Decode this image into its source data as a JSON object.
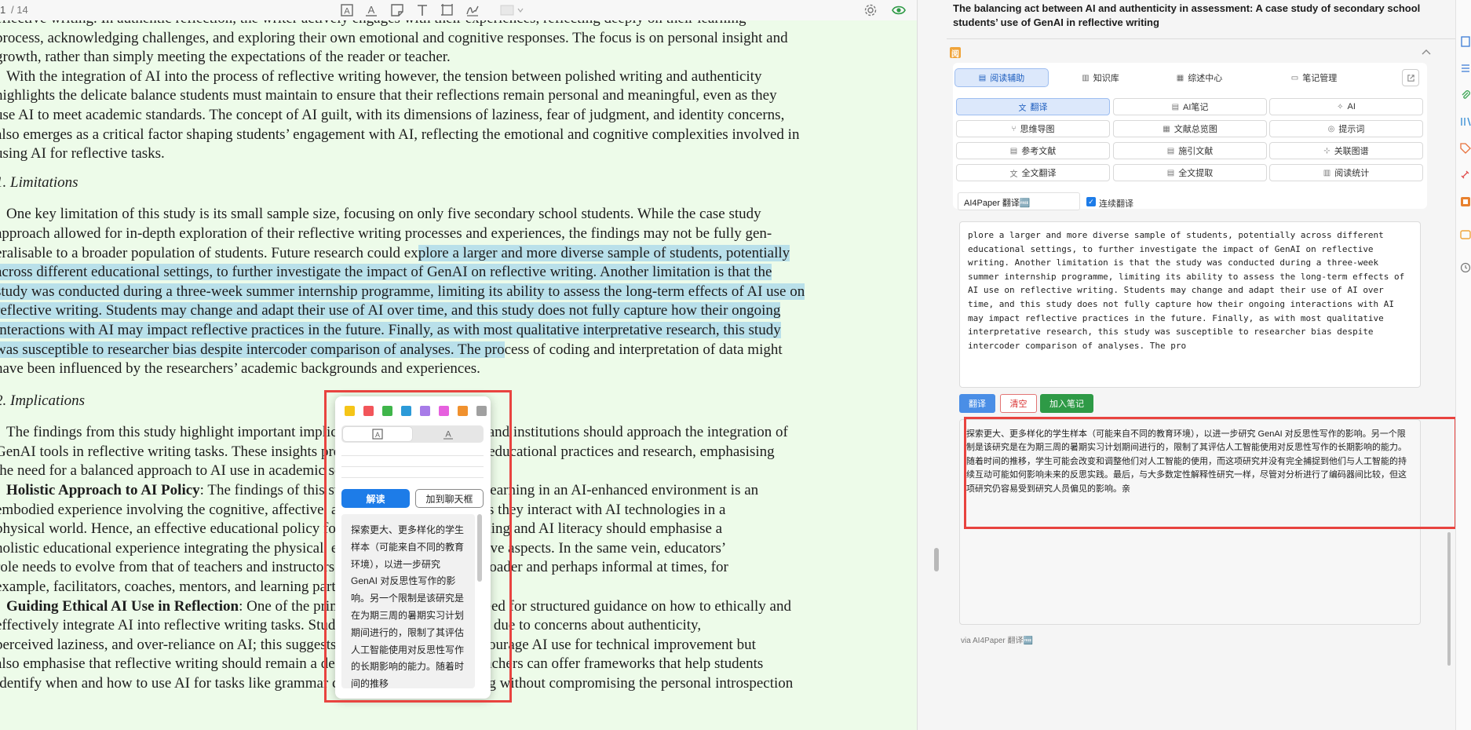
{
  "toolbar": {
    "page_current": "1",
    "page_total": "/ 14",
    "icons": [
      "text-box-icon",
      "text-highlight-icon",
      "note-icon",
      "text-icon",
      "area-select-icon",
      "signature-icon",
      "color-dropdown-icon",
      "gear-icon",
      "eye-icon",
      "search-icon"
    ]
  },
  "document": {
    "lines": [
      "eflective writing. In authentic reflection, the writer actively engages with their experiences, reflecting deeply on their learning",
      "process, acknowledging challenges, and exploring their own emotional and cognitive responses. The focus is on personal insight and",
      "growth, rather than simply meeting the expectations of the reader or teacher.",
      "With the integration of AI into the process of reflective writing however, the tension between polished writing and authenticity",
      "highlights the delicate balance students must maintain to ensure that their reflections remain personal and meaningful, even as they",
      "use AI to meet academic standards. The concept of AI guilt, with its dimensions of laziness, fear of judgment, and identity concerns,",
      "also emerges as a critical factor shaping students’ engagement with AI, reflecting the emotional and cognitive complexities involved in",
      "using AI for reflective tasks."
    ],
    "section_limitations": "1.   Limitations",
    "limit_line_1": "One key limitation of this study is its small sample size, focusing on only five secondary school students. While the case study",
    "limit_line_2": "approach allowed for in-depth exploration of their reflective writing processes and experiences, the findings may not be fully gen-",
    "limit_line_3_plain": "eralisable to a broader population of students. Future research could ex",
    "limit_line_3_hl": "plore a larger and more diverse sample of students, potentially",
    "limit_hl_lines": [
      "across different educational settings, to further investigate the impact of GenAI on reflective writing. Another limitation is that the",
      "study was conducted during a three-week summer internship programme, limiting its ability to assess the long-term effects of AI use on",
      "reflective writing. Students may change and adapt their use of AI over time, and this study does not fully capture how their ongoing",
      "interactions with AI may impact reflective practices in the future. Finally, as with most qualitative interpretative research, this study"
    ],
    "limit_line_8_hl": "was susceptible to researcher bias despite intercoder comparison of analyses. The pro",
    "limit_line_8_plain": "cess of coding and interpretation of data might",
    "limit_line_9": "have been influenced by the researchers’ academic backgrounds and experiences.",
    "section_implications": "2.   Implications",
    "impl_lines": [
      "The findings from this study highlight important implications for how educators and institutions should approach the integration of",
      "GenAI tools in reflective writing tasks. These insights provide guidance for future educational practices and research, emphasising",
      "the need for a balanced approach to AI use in academic settings."
    ],
    "holistic_bold": "Holistic Approach to AI Policy",
    "holistic_first": ": The findings of this study suggest that student learning in an AI-enhanced environment is an",
    "holistic_lines": [
      "embodied experience involving the cognitive, affective, and physical dimensions as they interact with AI technologies in a",
      "physical world. Hence, an effective educational policy for promoting genuine learning and AI literacy should emphasise a",
      "holistic educational experience integrating the physical, emotional and metacognitive aspects. In the same vein, educators’",
      "role needs to evolve from that of teachers and instructors to new roles which are broader and perhaps informal at times, for",
      "example, facilitators, coaches, mentors, and learning partners."
    ],
    "guiding_bold": "Guiding Ethical AI Use in Reflection",
    "guiding_first": ": One of the primary implications is the need for structured guidance on how to ethically and",
    "guiding_lines": [
      "effectively integrate AI into reflective writing tasks. Students experiencing AI guilt due to concerns about authenticity,",
      "perceived laziness, and over-reliance on AI; this suggests that schools not only encourage AI use for technical improvement but",
      "also emphasise that reflective writing should remain a deeply personal process. Teachers can offer frameworks that help students",
      "identify when and how to use AI for tasks like grammar correction or brainstorming without compromising the personal introspection"
    ]
  },
  "popup": {
    "swatch_colors": [
      "#f5c518",
      "#f2555a",
      "#3fb54a",
      "#2c9ad8",
      "#a77be8",
      "#e660de",
      "#f0912e",
      "#a0a0a0"
    ],
    "mode_a_icon": "A",
    "mode_b_icon": "A",
    "explain_label": "解读",
    "chat_label": "加到聊天框",
    "text": "探索更大、更多样化的学生样本（可能来自不同的教育环境），以进一步研究 GenAI 对反思性写作的影响。另一个限制是该研究是在为期三周的暑期实习计划期间进行的，限制了其评估人工智能使用对反思性写作的长期影响的能力。随着时间的推移"
  },
  "panel": {
    "title": "The balancing act between AI and authenticity in assessment: A case study of secondary school students’ use of GenAI in reflective writing",
    "logo_label": "阅",
    "tabs": [
      {
        "label": "阅读辅助",
        "icon": "▤",
        "active": true
      },
      {
        "label": "知识库",
        "icon": "▥",
        "active": false
      },
      {
        "label": "综述中心",
        "icon": "▦",
        "active": false
      },
      {
        "label": "笔记管理",
        "icon": "▭",
        "active": false
      }
    ],
    "features": [
      {
        "label": "翻译",
        "icon": "文",
        "active": true
      },
      {
        "label": "AI笔记",
        "icon": "▤",
        "active": false
      },
      {
        "label": "AI",
        "icon": "✧",
        "active": false
      },
      {
        "label": "思维导图",
        "icon": "⑂",
        "active": false
      },
      {
        "label": "文献总览图",
        "icon": "▦",
        "active": false
      },
      {
        "label": "提示词",
        "icon": "◎",
        "active": false
      },
      {
        "label": "参考文献",
        "icon": "▤",
        "active": false
      },
      {
        "label": "施引文献",
        "icon": "▤",
        "active": false
      },
      {
        "label": "关联图谱",
        "icon": "⊹",
        "active": false
      },
      {
        "label": "全文翻译",
        "icon": "文",
        "active": false
      },
      {
        "label": "全文提取",
        "icon": "▤",
        "active": false
      },
      {
        "label": "阅读统计",
        "icon": "▥",
        "active": false
      }
    ],
    "engine_label": "AI4Paper 翻译🆓",
    "continuous_label": "连续翻译",
    "continuous_checked": true,
    "source_text": "plore a larger and more diverse sample of students, potentially across different educational settings, to further investigate the impact of GenAI on reflective writing. Another limitation is that the study was conducted during a three-week summer internship programme, limiting its ability to assess the long-term effects of AI use on reflective writing. Students may change and adapt their use of AI over time, and this study does not fully capture how their ongoing interactions with AI may impact reflective practices in the future. Finally, as with most qualitative interpretative research, this study was susceptible to researcher bias despite intercoder comparison of analyses. The pro",
    "translate_label": "翻译",
    "clear_label": "清空",
    "add_note_label": "加入笔记",
    "output_text": "探索更大、更多样化的学生样本（可能来自不同的教育环境），以进一步研究 GenAI 对反思性写作的影响。另一个限制是该研究是在为期三周的暑期实习计划期间进行的，限制了其评估人工智能使用对反思性写作的长期影响的能力。随着时间的推移，学生可能会改变和调整他们对人工智能的使用，而这项研究并没有完全捕捉到他们与人工智能的持续互动可能如何影响未来的反思实践。最后，与大多数定性解释性研究一样，尽管对分析进行了编码器间比较，但这项研究仍容易受到研究人员偏见的影响。亲",
    "via_label": "via AI4Paper 翻译🆓"
  },
  "colors": {
    "highlight": "#b9e0ea",
    "doc_background": "#edfbe9",
    "accent_blue": "#1d7ce8",
    "annotation_red": "#e8433f",
    "add_note_green": "#2e9a46"
  }
}
